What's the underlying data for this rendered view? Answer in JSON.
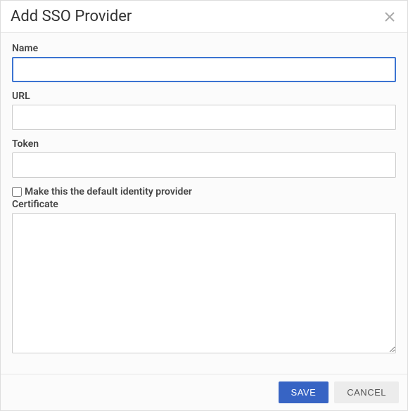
{
  "dialog": {
    "title": "Add SSO Provider"
  },
  "fields": {
    "name": {
      "label": "Name",
      "value": ""
    },
    "url": {
      "label": "URL",
      "value": ""
    },
    "token": {
      "label": "Token",
      "value": ""
    },
    "default_identity": {
      "label": "Make this the default identity provider",
      "checked": false
    },
    "certificate": {
      "label": "Certificate",
      "value": ""
    }
  },
  "buttons": {
    "save": "SAVE",
    "cancel": "CANCEL"
  }
}
